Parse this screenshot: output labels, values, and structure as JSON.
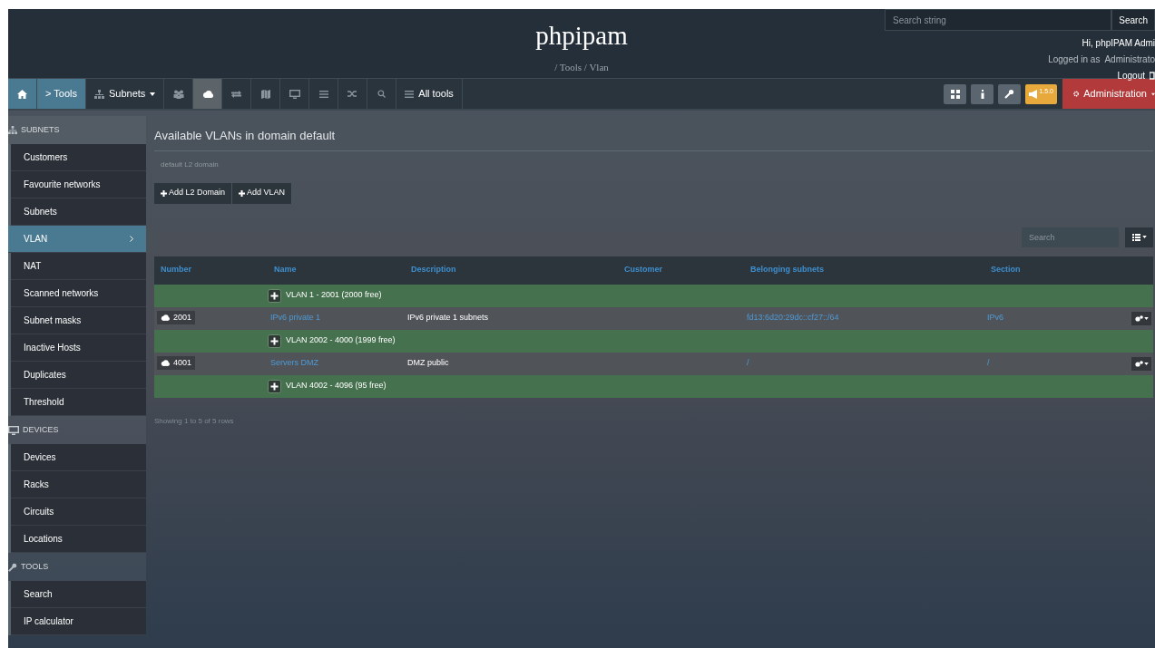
{
  "header": {
    "title": "phpipam",
    "breadcrumb": "/ Tools / Vlan",
    "search": {
      "placeholder": "Search string",
      "button": "Search"
    },
    "greeting": "Hi, phpIPAM Admi",
    "logged_in": "Logged in as  Administrato",
    "logout": "Logout"
  },
  "nav": {
    "items": [
      {
        "kind": "icon",
        "selected": true
      },
      {
        "kind": "text",
        "label": "> Tools",
        "selected": true
      },
      {
        "kind": "dropdown",
        "label": "Subnets",
        "selected": false
      },
      {
        "kind": "icon",
        "selected": false
      },
      {
        "kind": "icon",
        "selected": true
      },
      {
        "kind": "icon",
        "selected": false
      },
      {
        "kind": "icon",
        "selected": false
      },
      {
        "kind": "icon",
        "selected": false
      },
      {
        "kind": "icon",
        "selected": false
      },
      {
        "kind": "icon",
        "selected": false
      },
      {
        "kind": "icon",
        "selected": false
      },
      {
        "kind": "text",
        "label": "All tools",
        "selected": false
      }
    ],
    "version": "1.5.0",
    "admin": "Administration"
  },
  "sidebar": {
    "sections": [
      {
        "title": "SUBNETS",
        "items": [
          {
            "label": "Customers",
            "selected": false
          },
          {
            "label": "Favourite networks",
            "selected": false
          },
          {
            "label": "Subnets",
            "selected": false
          },
          {
            "label": "VLAN",
            "selected": true
          },
          {
            "label": "NAT",
            "selected": false
          },
          {
            "label": "Scanned networks",
            "selected": false
          },
          {
            "label": "Subnet masks",
            "selected": false
          },
          {
            "label": "Inactive Hosts",
            "selected": false
          },
          {
            "label": "Duplicates",
            "selected": false
          },
          {
            "label": "Threshold",
            "selected": false
          }
        ]
      },
      {
        "title": "DEVICES",
        "items": [
          {
            "label": "Devices",
            "selected": false
          },
          {
            "label": "Racks",
            "selected": false
          },
          {
            "label": "Circuits",
            "selected": false
          },
          {
            "label": "Locations",
            "selected": false
          }
        ]
      },
      {
        "title": "TOOLS",
        "items": [
          {
            "label": "Search",
            "selected": false
          },
          {
            "label": "IP calculator",
            "selected": false
          }
        ]
      }
    ]
  },
  "main": {
    "title": "Available VLANs in domain default",
    "subtitle": "default L2 domain",
    "buttons": [
      "Add L2 Domain",
      "Add VLAN"
    ],
    "table_search": {
      "placeholder": "Search"
    },
    "table": {
      "columns": [
        "Number",
        "Name",
        "Description",
        "Customer",
        "Belonging subnets",
        "Section"
      ],
      "rows": [
        {
          "kind": "free",
          "label": "VLAN 1 - 2001 (2000 free)"
        },
        {
          "kind": "vlan",
          "number": "2001",
          "name": "IPv6 private 1",
          "description": "IPv6 private 1 subnets",
          "subnets": "fd13:6d20:29dc::cf27::/64",
          "section": "IPv6"
        },
        {
          "kind": "free",
          "label": "VLAN 2002 - 4000 (1999 free)"
        },
        {
          "kind": "vlan",
          "number": "4001",
          "name": "Servers DMZ",
          "description": "DMZ public",
          "subnets": "/",
          "section": "/"
        },
        {
          "kind": "free",
          "label": "VLAN 4002 - 4096 (95 free)"
        }
      ]
    },
    "footer": "Showing 1 to 5 of 5 rows"
  }
}
